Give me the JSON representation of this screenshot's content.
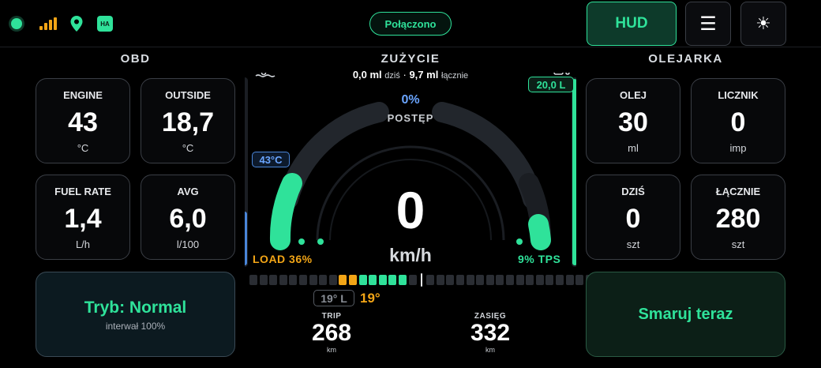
{
  "topbar": {
    "connection_label": "Połączono",
    "ha_label": "HA",
    "hud_label": "HUD",
    "menu_glyph": "☰",
    "theme_glyph": "☀",
    "status_color": "#2fe29a"
  },
  "obd": {
    "title": "OBD",
    "tiles": [
      {
        "label": "ENGINE",
        "value": "43",
        "unit": "°C"
      },
      {
        "label": "OUTSIDE",
        "value": "18,7",
        "unit": "°C"
      },
      {
        "label": "FUEL RATE",
        "value": "1,4",
        "unit": "L/h"
      },
      {
        "label": "AVG",
        "value": "6,0",
        "unit": "l/100"
      }
    ],
    "mode_title": "Tryb: Normal",
    "mode_sub": "interwał 100%"
  },
  "consumption": {
    "title": "ZUŻYCIE",
    "today_value": "0,0 ml",
    "today_label": "dziś",
    "sep": "·",
    "total_value": "9,7 ml",
    "total_label": "łącznie",
    "progress_pct": "0%",
    "progress_label": "POSTĘP",
    "speed": "0",
    "speed_unit": "km/h",
    "engine_temp_badge": "43°C",
    "fuel_badge": "20,0 L",
    "load_label": "LOAD 36%",
    "load_fraction": 0.36,
    "tps_label": "9% TPS",
    "tps_fraction": 0.09,
    "progress_fraction": 0.0,
    "temp_gray": "19° L",
    "temp_orange": "19°",
    "trip_label": "TRIP",
    "trip_value": "268",
    "trip_unit": "km",
    "range_label": "ZASIĘG",
    "range_value": "332",
    "range_unit": "km"
  },
  "oiler": {
    "title": "OLEJARKA",
    "tiles": [
      {
        "label": "OLEJ",
        "value": "30",
        "unit": "ml"
      },
      {
        "label": "LICZNIK",
        "value": "0",
        "unit": "imp"
      },
      {
        "label": "DZIŚ",
        "value": "0",
        "unit": "szt"
      },
      {
        "label": "ŁĄCZNIE",
        "value": "280",
        "unit": "szt"
      }
    ],
    "lube_button": "Smaruj teraz"
  },
  "colors": {
    "accent": "#2fe29a",
    "warning": "#f2a516",
    "info": "#6aa5ff"
  }
}
